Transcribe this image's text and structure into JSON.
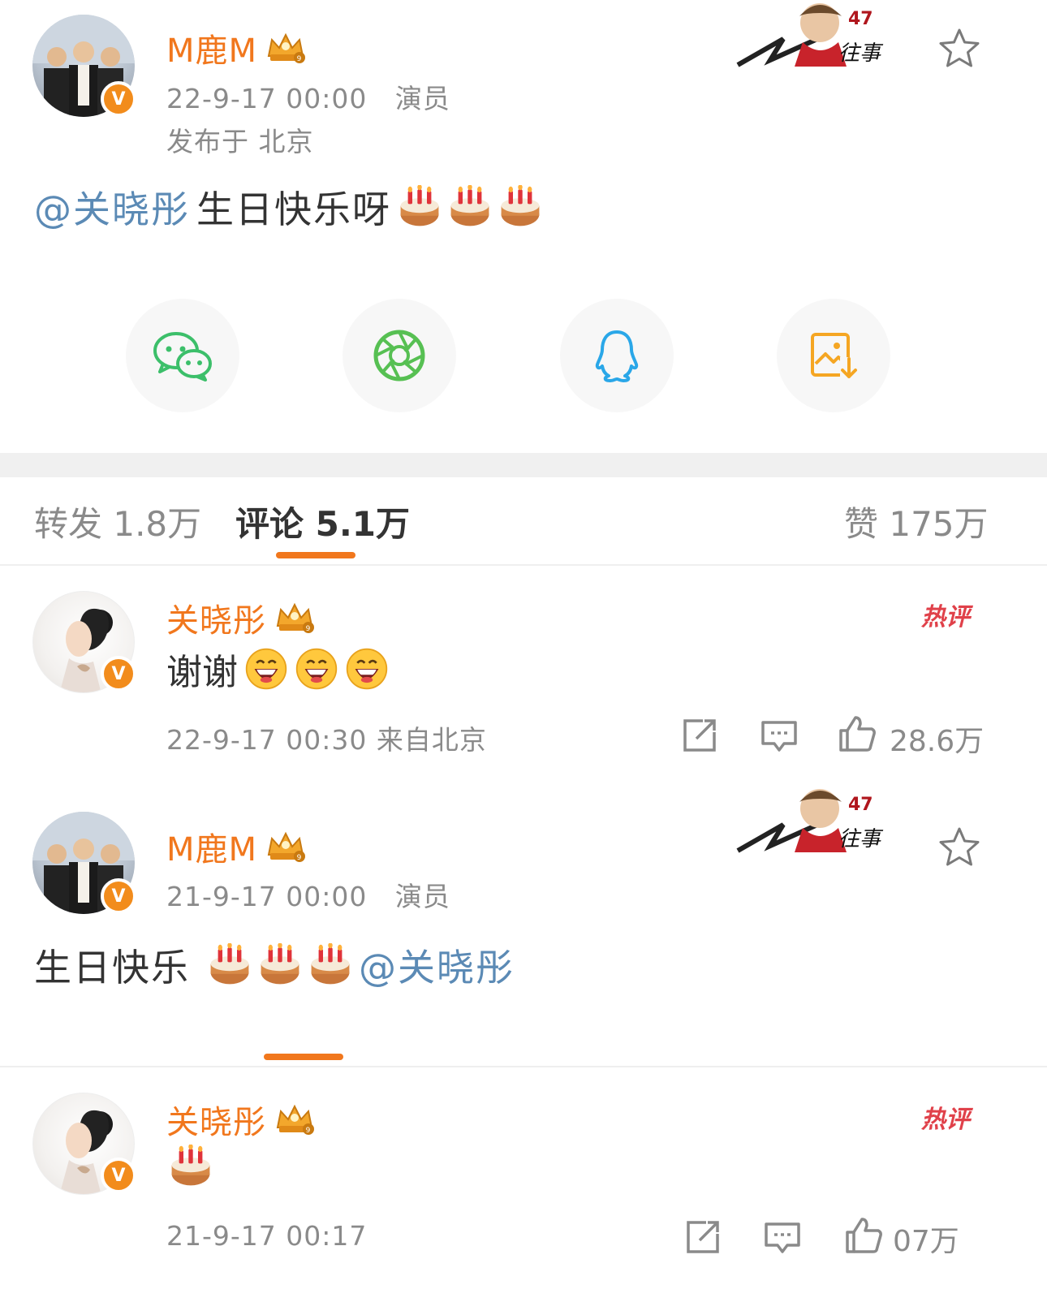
{
  "post1": {
    "username": "M鹿M",
    "time": "22-9-17 00:00",
    "role": "演员",
    "location": "发布于 北京",
    "mention": "@关晓彤",
    "text": "生日快乐呀"
  },
  "share": {
    "items": [
      "wechat-icon",
      "moments-icon",
      "qq-icon",
      "save-image-icon"
    ]
  },
  "tabs": {
    "repost": "转发 1.8万",
    "comment": "评论 5.1万",
    "like": "赞 175万"
  },
  "comment1": {
    "username": "关晓彤",
    "text": "谢谢",
    "hot": "热评",
    "time": "22-9-17 00:30 来自北京",
    "likes": "28.6万"
  },
  "post2": {
    "username": "M鹿M",
    "time": "21-9-17 00:00",
    "role": "演员",
    "text": "生日快乐",
    "mention": "@关晓彤"
  },
  "comment2": {
    "username": "关晓彤",
    "hot": "热评",
    "time": "21-9-17 00:17",
    "likes": "07万"
  },
  "colors": {
    "accent": "#f1771d",
    "mention": "#5b8ab5",
    "hot": "#e0414a",
    "meta": "#8a8a8a"
  }
}
